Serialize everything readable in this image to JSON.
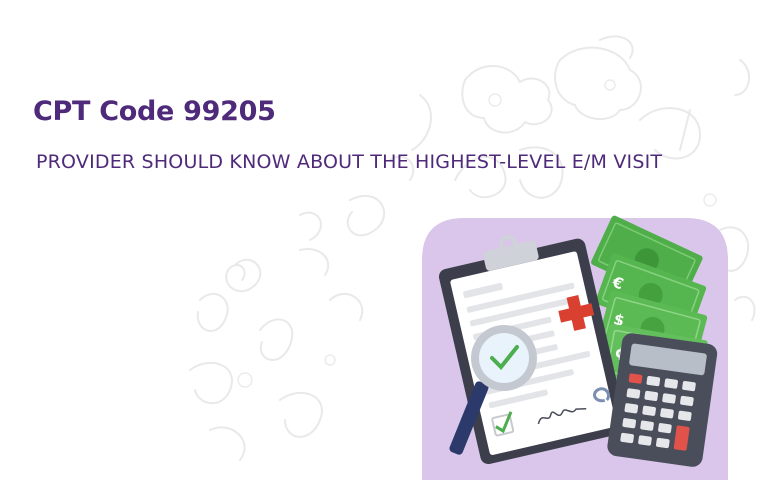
{
  "header": {
    "title": "CPT Code 99205",
    "subtitle": "PROVIDER SHOULD KNOW ABOUT THE HIGHEST-LEVEL E/M VISIT"
  },
  "colors": {
    "title_text": "#4f2a7a",
    "panel_background": "#d9c6ea",
    "clipboard": "#3c3f4b",
    "banknote": "#55b54f",
    "medical_cross": "#d9402f",
    "calculator": "#4a4e5a",
    "magnifier_handle": "#2b3a6b",
    "doodle_lines": "#e6e6e6"
  },
  "icons": [
    "clipboard-icon",
    "medical-cross-icon",
    "magnifying-glass-icon",
    "banknotes-icon",
    "calculator-icon",
    "checkmark-icon",
    "signature-icon"
  ],
  "illustration": {
    "currency_symbols": [
      "€",
      "$",
      "¢"
    ]
  }
}
